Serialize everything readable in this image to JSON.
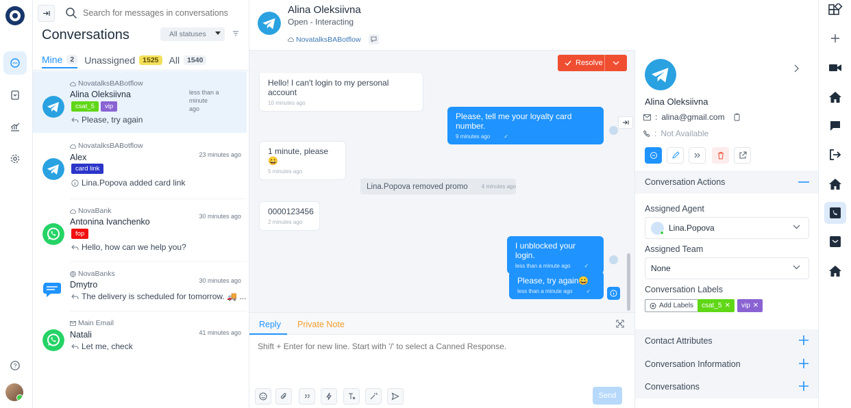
{
  "search": {
    "placeholder": "Search for messages in conversations"
  },
  "list": {
    "title": "Conversations",
    "status_filter": "All statuses",
    "tabs": [
      {
        "label": "Mine",
        "count": "2"
      },
      {
        "label": "Unassigned",
        "count": "1525"
      },
      {
        "label": "All",
        "count": "1540"
      }
    ],
    "conversations": [
      {
        "inbox": "NovatalksBABotflow",
        "name": "Alina Oleksiivna",
        "time_line1": "less than a minute",
        "time_line2": "ago",
        "labels": [
          "csat_5",
          "vip"
        ],
        "message": "Please, try again",
        "channel": "telegram"
      },
      {
        "inbox": "NovatalksBABotflow",
        "name": "Alex",
        "time": "23 minutes ago",
        "labels": [
          "card link"
        ],
        "message": "Lina.Popova added card link",
        "channel": "telegram"
      },
      {
        "inbox": "NovaBank",
        "name": "Antonina Ivanchenko",
        "time": "30 minutes ago",
        "labels": [
          "fop"
        ],
        "message": "Hello, how can we help you?",
        "channel": "whatsapp"
      },
      {
        "inbox": "NovaBanks",
        "name": "Dmytro",
        "time": "30 minutes ago",
        "labels": [],
        "message": "The delivery is scheduled for tomorrow. 🚚 ...",
        "channel": "chat"
      },
      {
        "inbox": "Main Email",
        "name": "Natali",
        "time": "41 minutes ago",
        "labels": [],
        "message": "Let me, check",
        "channel": "whatsapp"
      }
    ]
  },
  "label_colors": {
    "csat_5": "#5fd716",
    "vip": "#8a63d2",
    "card link": "#2b35c9",
    "fop": "#f20e0e"
  },
  "chat": {
    "contact_name": "Alina Oleksiivna",
    "status": "Open - Interacting",
    "inbox": "NovatalksBABotflow",
    "resolve_label": "Resolve",
    "messages": [
      {
        "type": "incoming",
        "text": "Hello! I can't login to my personal account",
        "time": "10 minutes ago"
      },
      {
        "type": "outgoing",
        "text": "Please, tell me your loyalty card number.",
        "time": "9 minutes ago"
      },
      {
        "type": "incoming",
        "text": "1 minute, please 😀",
        "time": "5 minutes ago"
      },
      {
        "type": "activity",
        "text": "Lina.Popova removed promo",
        "time": "4 minutes ago"
      },
      {
        "type": "incoming",
        "text": "0000123456",
        "time": "2 minutes ago"
      },
      {
        "type": "outgoing",
        "text": "I unblocked your login.",
        "time": "less than a minute ago"
      },
      {
        "type": "outgoing",
        "text": "Please, try again😀",
        "time": "less than a minute ago"
      }
    ],
    "reply_tab": "Reply",
    "note_tab": "Private Note",
    "reply_placeholder": "Shift + Enter for new line. Start with '/' to select a Canned Response.",
    "send_label": "Send"
  },
  "contact": {
    "name": "Alina Oleksiivna",
    "email": "alina@gmail.com",
    "phone": "Not Available",
    "sections": {
      "actions": "Conversation Actions",
      "attributes": "Contact Attributes",
      "info": "Conversation Information",
      "conversations": "Conversations"
    },
    "assigned_agent_label": "Assigned Agent",
    "assigned_agent": "Lina.Popova",
    "assigned_team_label": "Assigned Team",
    "assigned_team": "None",
    "labels_title": "Conversation Labels",
    "add_labels": "Add Labels",
    "labels": [
      "csat_5",
      "vip"
    ]
  },
  "colors": {
    "accent": "#1f93ff",
    "resolve": "#f04e31",
    "brand": "#17366b",
    "telegram": "#2aa1e0",
    "whatsapp": "#25d366"
  }
}
